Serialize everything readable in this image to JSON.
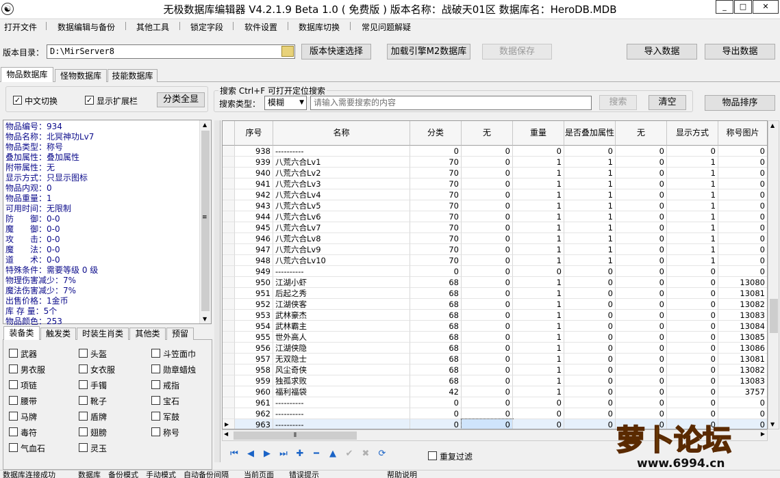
{
  "window": {
    "title": "无极数据库编辑器 V4.2.1.9    Beta 1.0 ( 免费版 )    版本名称：战破天01区    数据库名：HeroDB.MDB",
    "icon": "yin-yang-icon",
    "controls": [
      "_",
      "□",
      "✕"
    ]
  },
  "menu": [
    "打开文件",
    "数据编辑与备份",
    "其他工具",
    "锁定字段",
    "软件设置",
    "数据库切换",
    "常见问题解疑"
  ],
  "toolbar": {
    "dir_label": "版本目录：",
    "dir_value": "D:\\MirServer8",
    "quick_select": "版本快速选择",
    "load_engine": "加载引擎M2数据库",
    "save": "数据保存",
    "import": "导入数据",
    "export": "导出数据"
  },
  "tabs": [
    "物品数据库",
    "怪物数据库",
    "技能数据库"
  ],
  "options": {
    "chinese_toggle": "中文切换",
    "show_ext": "显示扩展栏",
    "show_all": "分类全显",
    "search_title": "搜索   Ctrl+F 可打开定位搜索",
    "search_type_label": "搜索类型：",
    "search_type": "模糊",
    "search_placeholder": "请输入需要搜索的内容",
    "search_btn": "搜索",
    "clear_btn": "清空",
    "sort_btn": "物品排序"
  },
  "info": [
    "物品编号：934",
    "物品名称：北冥神功Lv7",
    "物品类型：称号",
    "叠加属性：叠加属性",
    "附带属性：无",
    "显示方式：只显示图标",
    "物品内观：0",
    "物品重量：1",
    "可用时间：无限制",
    "防　　御：0-0",
    "魔　　御：0-0",
    "攻　　击：0-0",
    "魔　　法：0-0",
    "道　　术：0-0",
    "特殊条件：需要等级 0 级",
    "物理伤害减少：7%",
    "魔法伤害减少：7%",
    "出售价格：1金币",
    "库 存 量：5个",
    "物品颜色：253"
  ],
  "category_tabs": [
    "装备类",
    "触发类",
    "时装生肖类",
    "其他类",
    "预留"
  ],
  "categories": [
    "武器",
    "头盔",
    "斗笠面巾",
    "男衣服",
    "女衣服",
    "勋章蜡烛",
    "项链",
    "手镯",
    "戒指",
    "腰带",
    "靴子",
    "宝石",
    "马牌",
    "盾牌",
    "军鼓",
    "毒符",
    "翅膀",
    "称号",
    "气血石",
    "灵玉"
  ],
  "grid": {
    "columns": [
      "序号",
      "名称",
      "分类",
      "无",
      "重量",
      "是否叠加属性",
      "无",
      "显示方式",
      "称号图片"
    ],
    "rows": [
      [
        "938",
        "----------",
        "0",
        "0",
        "0",
        "0",
        "0",
        "0",
        "0"
      ],
      [
        "939",
        "八荒六合Lv1",
        "70",
        "0",
        "1",
        "1",
        "0",
        "1",
        "0"
      ],
      [
        "940",
        "八荒六合Lv2",
        "70",
        "0",
        "1",
        "1",
        "0",
        "1",
        "0"
      ],
      [
        "941",
        "八荒六合Lv3",
        "70",
        "0",
        "1",
        "1",
        "0",
        "1",
        "0"
      ],
      [
        "942",
        "八荒六合Lv4",
        "70",
        "0",
        "1",
        "1",
        "0",
        "1",
        "0"
      ],
      [
        "943",
        "八荒六合Lv5",
        "70",
        "0",
        "1",
        "1",
        "0",
        "1",
        "0"
      ],
      [
        "944",
        "八荒六合Lv6",
        "70",
        "0",
        "1",
        "1",
        "0",
        "1",
        "0"
      ],
      [
        "945",
        "八荒六合Lv7",
        "70",
        "0",
        "1",
        "1",
        "0",
        "1",
        "0"
      ],
      [
        "946",
        "八荒六合Lv8",
        "70",
        "0",
        "1",
        "1",
        "0",
        "1",
        "0"
      ],
      [
        "947",
        "八荒六合Lv9",
        "70",
        "0",
        "1",
        "1",
        "0",
        "1",
        "0"
      ],
      [
        "948",
        "八荒六合Lv10",
        "70",
        "0",
        "1",
        "1",
        "0",
        "1",
        "0"
      ],
      [
        "949",
        "----------",
        "0",
        "0",
        "0",
        "0",
        "0",
        "0",
        "0"
      ],
      [
        "950",
        "江湖小虾",
        "68",
        "0",
        "1",
        "0",
        "0",
        "0",
        "13080"
      ],
      [
        "951",
        "后起之秀",
        "68",
        "0",
        "1",
        "0",
        "0",
        "0",
        "13081"
      ],
      [
        "952",
        "江湖侠客",
        "68",
        "0",
        "1",
        "0",
        "0",
        "0",
        "13082"
      ],
      [
        "953",
        "武林豪杰",
        "68",
        "0",
        "1",
        "0",
        "0",
        "0",
        "13083"
      ],
      [
        "954",
        "武林霸主",
        "68",
        "0",
        "1",
        "0",
        "0",
        "0",
        "13084"
      ],
      [
        "955",
        "世外高人",
        "68",
        "0",
        "1",
        "0",
        "0",
        "0",
        "13085"
      ],
      [
        "956",
        "江湖侠隐",
        "68",
        "0",
        "1",
        "0",
        "0",
        "0",
        "13086"
      ],
      [
        "957",
        "无双隐士",
        "68",
        "0",
        "1",
        "0",
        "0",
        "0",
        "13081"
      ],
      [
        "958",
        "风尘奇侠",
        "68",
        "0",
        "1",
        "0",
        "0",
        "0",
        "13082"
      ],
      [
        "959",
        "独孤求败",
        "68",
        "0",
        "1",
        "0",
        "0",
        "0",
        "13083"
      ],
      [
        "960",
        "福利福袋",
        "42",
        "0",
        "1",
        "0",
        "0",
        "0",
        "3757"
      ],
      [
        "961",
        "----------",
        "0",
        "0",
        "0",
        "0",
        "0",
        "0",
        "0"
      ],
      [
        "962",
        "----------",
        "0",
        "0",
        "0",
        "0",
        "0",
        "0",
        "0"
      ],
      [
        "963",
        "----------",
        "0",
        "0",
        "0",
        "0",
        "0",
        "0",
        "0"
      ]
    ]
  },
  "nav_icons": [
    "first-icon",
    "prior-icon",
    "next-icon",
    "last-icon",
    "insert-icon",
    "delete-icon",
    "edit-icon",
    "post-icon",
    "cancel-icon",
    "refresh-icon"
  ],
  "repeat_filter": "重复过滤",
  "watermark": "萝卜论坛 www.6994.cn",
  "statusbar": "数据库连接成功　　　数据库　备份模式　手动模式　自动备份间隔　　当前页面　　错误提示　　　　　　　　　帮助说明"
}
